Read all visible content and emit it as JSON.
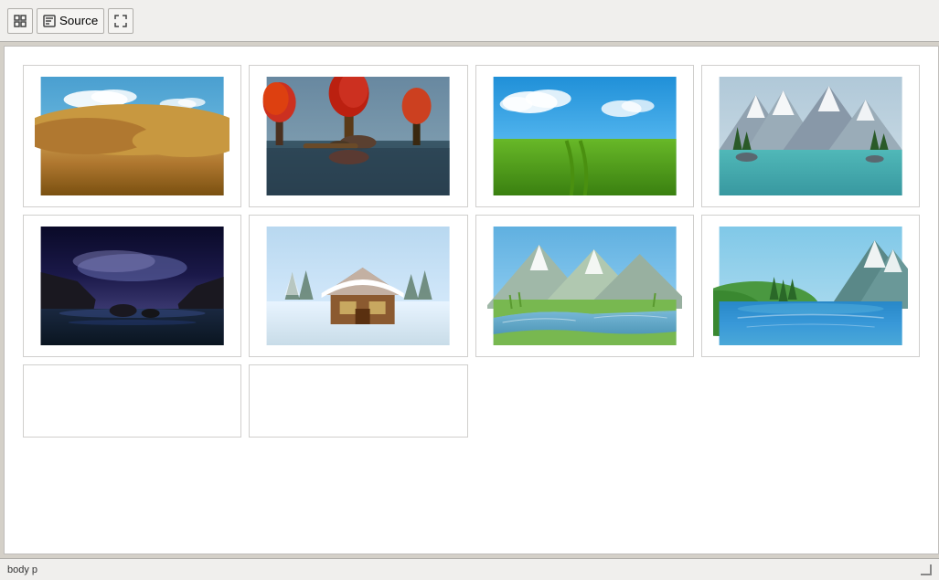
{
  "toolbar": {
    "grid_icon": "grid",
    "source_label": "Source",
    "fullscreen_icon": "fullscreen"
  },
  "images": [
    {
      "id": "desert",
      "alt": "Desert landscape with sand dunes and blue sky"
    },
    {
      "id": "autumn-lake",
      "alt": "Autumn forest with red trees by a lake"
    },
    {
      "id": "green-field",
      "alt": "Green grass field with blue sky and clouds"
    },
    {
      "id": "mountain-lake",
      "alt": "Mountain lake with pine trees and rocky peaks"
    },
    {
      "id": "coast-sunset",
      "alt": "Rocky coast at sunset with dramatic sky"
    },
    {
      "id": "winter-cabin",
      "alt": "Snow covered cabin in winter landscape"
    },
    {
      "id": "mountain-river",
      "alt": "Mountain river with reflections"
    },
    {
      "id": "blue-lake",
      "alt": "Clear blue mountain lake"
    },
    {
      "id": "empty1",
      "alt": ""
    },
    {
      "id": "empty2",
      "alt": ""
    }
  ],
  "status": {
    "text": "body p"
  }
}
